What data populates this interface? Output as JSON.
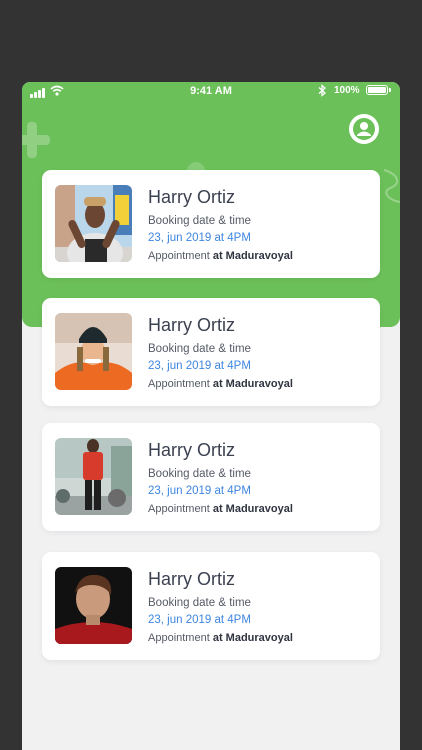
{
  "status_bar": {
    "time": "9:41 AM",
    "battery": "100%"
  },
  "header": {
    "profile_icon": "user-circle-icon"
  },
  "appointments": [
    {
      "name": "Harry Ortiz",
      "booking_label": "Booking date & time",
      "date": "23, jun 2019 at 4PM",
      "appointment_prefix": "Appointment",
      "location": "at Maduravoyal"
    },
    {
      "name": "Harry Ortiz",
      "booking_label": "Booking date & time",
      "date": "23, jun 2019 at 4PM",
      "appointment_prefix": "Appointment",
      "location": "at Maduravoyal"
    },
    {
      "name": "Harry Ortiz",
      "booking_label": "Booking date & time",
      "date": "23, jun 2019 at 4PM",
      "appointment_prefix": "Appointment",
      "location": "at Maduravoyal"
    },
    {
      "name": "Harry Ortiz",
      "booking_label": "Booking date & time",
      "date": "23, jun 2019 at 4PM",
      "appointment_prefix": "Appointment",
      "location": "at Maduravoyal"
    }
  ],
  "colors": {
    "accent": "#6cc05a",
    "date_text": "#3e86e0",
    "frame": "#333333"
  }
}
